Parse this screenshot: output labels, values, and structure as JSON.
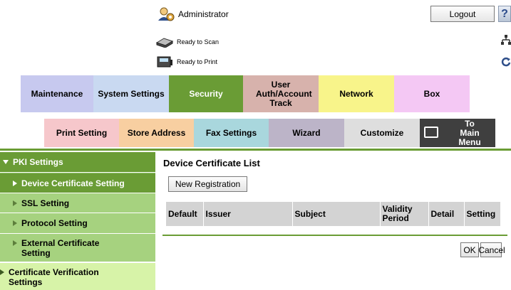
{
  "header": {
    "user_name": "Administrator",
    "logout_label": "Logout",
    "help_label": "?",
    "scan_status": "Ready to Scan",
    "print_status": "Ready to Print"
  },
  "tabs_row1": [
    {
      "label": "Maintenance"
    },
    {
      "label": "System Settings"
    },
    {
      "label": "Security",
      "active": true
    },
    {
      "label": "User Auth/Account Track"
    },
    {
      "label": "Network"
    },
    {
      "label": "Box"
    }
  ],
  "tabs_row2": [
    {
      "label": "Print Setting"
    },
    {
      "label": "Store Address"
    },
    {
      "label": "Fax Settings"
    },
    {
      "label": "Wizard"
    },
    {
      "label": "Customize"
    },
    {
      "label": "To Main Menu"
    }
  ],
  "sidebar": {
    "items": [
      {
        "label": "PKI Settings"
      },
      {
        "label": "Device Certificate Setting",
        "selected": true
      },
      {
        "label": "SSL Setting"
      },
      {
        "label": "Protocol Setting"
      },
      {
        "label": "External Certificate Setting"
      },
      {
        "label": "Certificate Verification Settings"
      }
    ]
  },
  "main": {
    "title": "Device Certificate List",
    "new_registration_label": "New Registration",
    "table_headers": [
      "Default",
      "Issuer",
      "Subject",
      "Validity Period",
      "Detail",
      "Setting"
    ],
    "ok_label": "OK",
    "cancel_label": "Cancel"
  },
  "colors": {
    "accent_green": "#6a9c35",
    "sidebar_light_green": "#a6d27f",
    "sidebar_pale_green": "#d7f3a8"
  },
  "icons": {
    "user": "admin-user-icon",
    "help": "help-icon",
    "scan": "scanner-icon",
    "print": "printer-icon",
    "network": "network-map-icon",
    "refresh": "refresh-icon",
    "main_menu": "main-menu-icon"
  }
}
